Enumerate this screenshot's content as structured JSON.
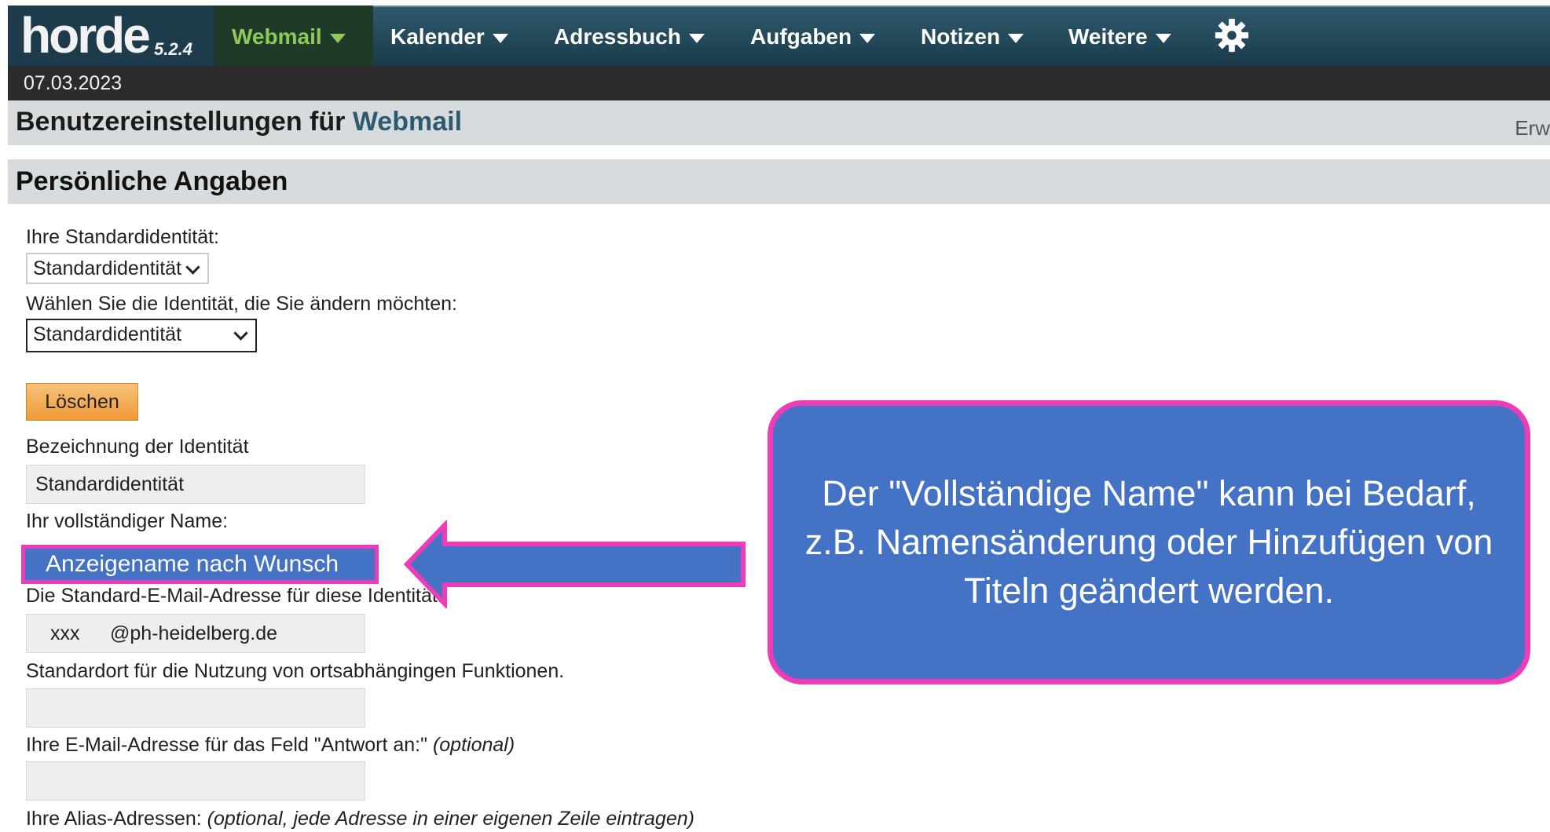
{
  "app": {
    "logo": "horde",
    "version": "5.2.4"
  },
  "nav": {
    "items": [
      {
        "label": "Webmail",
        "active": true
      },
      {
        "label": "Kalender"
      },
      {
        "label": "Adressbuch"
      },
      {
        "label": "Aufgaben"
      },
      {
        "label": "Notizen"
      },
      {
        "label": "Weitere"
      }
    ],
    "settings_icon": "gear-icon"
  },
  "date": "07.03.2023",
  "header": {
    "title_prefix": "Benutzereinstellungen für",
    "title_app": "Webmail",
    "right_text": "Erw"
  },
  "section": {
    "title": "Persönliche Angaben"
  },
  "form": {
    "default_identity_label": "Ihre Standardidentität:",
    "default_identity_value": "Standardidentität",
    "edit_identity_label": "Wählen Sie die Identität, die Sie ändern möchten:",
    "edit_identity_value": "Standardidentität",
    "delete_button": "Löschen",
    "identity_name_label": "Bezeichnung der Identität",
    "identity_name_value": "Standardidentität",
    "full_name_label": "Ihr vollständiger Name:",
    "full_name_value": "Anzeigename nach Wunsch",
    "email_label": "Die Standard-E-Mail-Adresse für diese Identität:",
    "email_local": "xxx",
    "email_domain": "@ph-heidelberg.de",
    "location_label": "Standardort für die Nutzung von ortsabhängingen Funktionen.",
    "location_value": "",
    "replyto_label": "Ihre E-Mail-Adresse für das Feld \"Antwort an:\"",
    "replyto_optional": "(optional)",
    "replyto_value": "",
    "alias_label": "Ihre Alias-Adressen:",
    "alias_hint": "(optional, jede Adresse in einer eigenen Zeile eintragen)"
  },
  "callout": {
    "text": "Der \"Vollständige Name\" kann bei Bedarf, z.B. Namensänderung oder Hinzufügen von Titeln geändert werden."
  },
  "colors": {
    "callout_fill": "#4472c4",
    "callout_border": "#ee3bb8",
    "active_nav": "#8fc95a",
    "delete_button": "#f2a64a"
  }
}
